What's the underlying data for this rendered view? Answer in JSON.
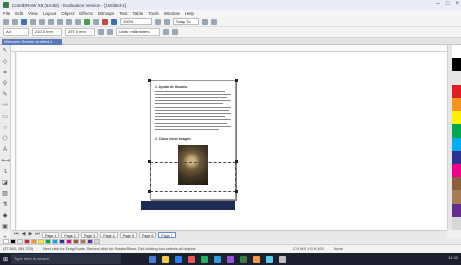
{
  "window": {
    "title": "CorelDRAW X8 (64-Bit) - Evaluation Version - [Untitled-1]"
  },
  "menu": {
    "items": [
      "File",
      "Edit",
      "View",
      "Layout",
      "Object",
      "Effects",
      "Bitmaps",
      "Text",
      "Table",
      "Tools",
      "Window",
      "Help"
    ]
  },
  "toolbar": {
    "zoom_value": "100%",
    "snap_label": "Snap To"
  },
  "propbar": {
    "page_size": "A4",
    "width_value": "210.0 mm",
    "height_value": "297.0 mm",
    "units_label": "Units: millimeters"
  },
  "doc_tab": {
    "label": "Welcome Screen    Untitled-1"
  },
  "page": {
    "heading1": "1. Ayuda de Usuario",
    "heading2": "2. Cómo mirar imagen"
  },
  "page_nav": {
    "tabs": [
      "Page 1",
      "Page 2",
      "Page 3",
      "Page 4",
      "Page 5",
      "Page 6",
      "Page 7"
    ],
    "active_index": 6
  },
  "status": {
    "coords": "(37.563, 284.703)",
    "hint": "Next click for Drag/Scale; Second click for Rotate/Skew; Dbl-clicking tool selects all objects",
    "fill_label": "C:0 M:0 Y:0 K:100",
    "outline_label": "None"
  },
  "taskbar": {
    "search_placeholder": "Type here to search",
    "time": "11:32"
  },
  "colors": {
    "accent": "#5a79b8",
    "footer_band": "#1d2b55",
    "palette": [
      "#ffffff",
      "#000000",
      "#e5e5e5",
      "#e31b23",
      "#f7941d",
      "#fff200",
      "#00a651",
      "#00aeef",
      "#2e3192",
      "#ec008c",
      "#8b5e3c",
      "#a67c52",
      "#662d91",
      "#d7d7d7"
    ]
  }
}
